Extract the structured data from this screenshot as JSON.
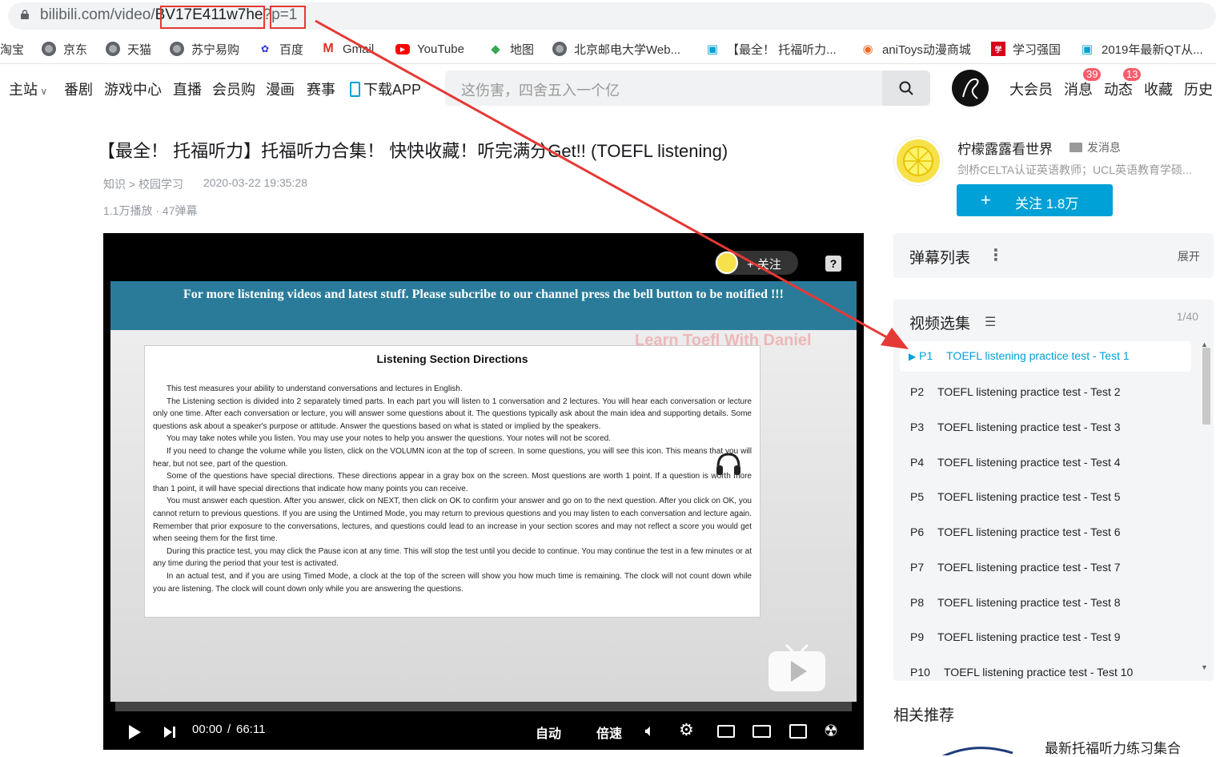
{
  "browser": {
    "url_host": "bilibili.com/video/",
    "url_bvid": "BV17E411w7he",
    "url_query": "?p=1"
  },
  "bookmarks": [
    {
      "label": "淘宝",
      "icon": "taobao-icon"
    },
    {
      "label": "京东",
      "icon": "globe-icon"
    },
    {
      "label": "天猫",
      "icon": "globe-icon"
    },
    {
      "label": "苏宁易购",
      "icon": "globe-icon"
    },
    {
      "label": "百度",
      "icon": "baidu-paw-icon"
    },
    {
      "label": "Gmail",
      "icon": "gmail-icon"
    },
    {
      "label": "YouTube",
      "icon": "youtube-icon"
    },
    {
      "label": "地图",
      "icon": "maps-icon"
    },
    {
      "label": "北京邮电大学Web...",
      "icon": "globe-icon"
    },
    {
      "label": "【最全！ 托福听力...",
      "icon": "bilibili-tv-icon"
    },
    {
      "label": "aniToys动漫商城",
      "icon": "anitoys-icon"
    },
    {
      "label": "学习强国",
      "icon": "xuexi-icon"
    },
    {
      "label": "2019年最新QT从...",
      "icon": "bilibili-tv-icon"
    }
  ],
  "nav": {
    "items": [
      "主站",
      "番剧",
      "游戏中心",
      "直播",
      "会员购",
      "漫画",
      "赛事",
      "下载APP"
    ],
    "search_placeholder": "这伤害，四舍五入一个亿",
    "right": [
      "大会员",
      "消息",
      "动态",
      "收藏",
      "历史"
    ],
    "badges": {
      "messages": "39",
      "dynamics": "13"
    }
  },
  "video": {
    "title": "【最全！ 托福听力】托福听力合集！ 快快收藏！听完满分Get!! (TOEFL listening)",
    "category": "知识 > 校园学习",
    "date": "2020-03-22 19:35:28",
    "stats": "1.1万播放 · 47弹幕"
  },
  "player": {
    "follow_label": "+ 关注",
    "banner": "For more listening videos and latest stuff. Please subcribe to our channel press the bell button to be notified !!!",
    "watermark": "Learn Toefl With Daniel",
    "doc_title": "Listening Section Directions",
    "doc_paragraphs": [
      "This test measures your ability to understand conversations and lectures in English.",
      "The Listening section is divided into 2 separately timed parts. In each part you will listen to 1 conversation and 2 lectures. You will hear each conversation or lecture only one time. After each conversation or lecture, you will answer some questions about it. The questions typically ask about the main idea and supporting details. Some questions ask about a speaker's purpose or attitude. Answer the questions based on what is stated or implied by the speakers.",
      "You may take notes while you listen. You may use your notes to help you answer the questions. Your notes will not be scored.",
      "If you need to change the volume while you listen, click on the VOLUMN icon at the top of screen. In some questions, you will see this icon. This means that you will hear, but not see, part of the question.",
      "Some of the questions have special directions. These directions appear in a gray box on the screen. Most questions are worth 1 point. If a question is worth more than 1 point, it will have special directions that indicate how many points you can receive.",
      "You must answer each question. After you answer, click on NEXT, then click on OK to confirm your answer and go on to the next question. After you click on OK, you cannot return to previous questions. If you are using the Untimed Mode, you may return to previous questions and you may listen to each conversation and lecture again. Remember that prior exposure to the conversations, lectures, and questions could lead to an increase in your section scores and may not reflect a score you would get when seeing them for the first time.",
      "During this practice test, you may click the Pause icon at any time. This will stop the test until you decide to continue. You may continue the test in a few minutes or at any time during the period that your test is activated.",
      "In an actual test, and if you are using Timed Mode, a clock at the top of the screen will show you how much time is remaining. The clock will not count down while you are listening. The clock will count down only while you are answering the questions."
    ],
    "time_current": "00:00",
    "time_sep": "/",
    "time_total": "66:11",
    "auto_label": "自动",
    "speed_label": "倍速"
  },
  "uploader": {
    "name": "柠檬露露看世界",
    "message_label": "发消息",
    "desc": "剑桥CELTA认证英语教师；UCL英语教育学硕...",
    "follow_label": "关注 1.8万"
  },
  "danmaku": {
    "title": "弹幕列表",
    "expand": "展开"
  },
  "playlist": {
    "title": "视频选集",
    "counter": "1/40",
    "episodes": [
      {
        "n": "P1",
        "title": "TOEFL listening practice test - Test 1"
      },
      {
        "n": "P2",
        "title": "TOEFL listening practice test - Test 2"
      },
      {
        "n": "P3",
        "title": "TOEFL listening practice test - Test 3"
      },
      {
        "n": "P4",
        "title": "TOEFL listening practice test - Test 4"
      },
      {
        "n": "P5",
        "title": "TOEFL listening practice test - Test 5"
      },
      {
        "n": "P6",
        "title": "TOEFL listening practice test - Test 6"
      },
      {
        "n": "P7",
        "title": "TOEFL listening practice test - Test 7"
      },
      {
        "n": "P8",
        "title": "TOEFL listening practice test - Test 8"
      },
      {
        "n": "P9",
        "title": "TOEFL listening practice test - Test 9"
      },
      {
        "n": "P10",
        "title": "TOEFL listening practice test - Test 10"
      }
    ]
  },
  "recommend": {
    "title": "相关推荐",
    "first_item": "最新托福听力练习集合"
  },
  "colors": {
    "accent": "#00a1d6",
    "annotation": "#e53935",
    "badge": "#fb5b6a"
  }
}
